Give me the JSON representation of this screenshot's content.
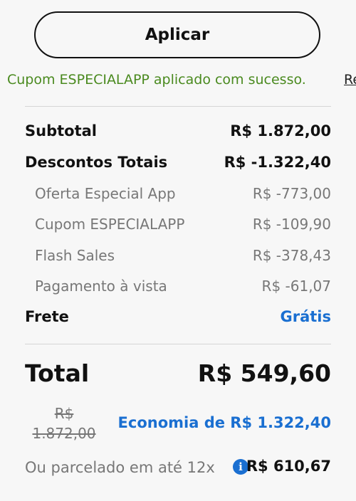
{
  "coupon": {
    "apply_label": "Aplicar",
    "success_message": "Cupom ESPECIALAPP aplicado com sucesso.",
    "remove_label": "Re"
  },
  "summary": {
    "subtotal_label": "Subtotal",
    "subtotal_value": "R$ 1.872,00",
    "discounts_label": "Descontos Totais",
    "discounts_value": "R$ -1.322,40",
    "discount_items": [
      {
        "label": "Oferta Especial App",
        "value": "R$ -773,00"
      },
      {
        "label": "Cupom ESPECIALAPP",
        "value": "R$ -109,90"
      },
      {
        "label": "Flash Sales",
        "value": "R$ -378,43"
      },
      {
        "label": "Pagamento à vista",
        "value": "R$ -61,07"
      }
    ],
    "shipping_label": "Frete",
    "shipping_value": "Grátis"
  },
  "total": {
    "label": "Total",
    "value": "R$ 549,60",
    "old_price_currency": "R$",
    "old_price_amount": "1.872,00",
    "economy_text": "Economia de R$ 1.322,40",
    "installment_text": "Ou parcelado em até 12x",
    "installment_value": "R$ 610,67"
  },
  "colors": {
    "success": "#4a8a1f",
    "accent": "#1a6fd1"
  },
  "icons": {
    "info": "info-icon"
  }
}
